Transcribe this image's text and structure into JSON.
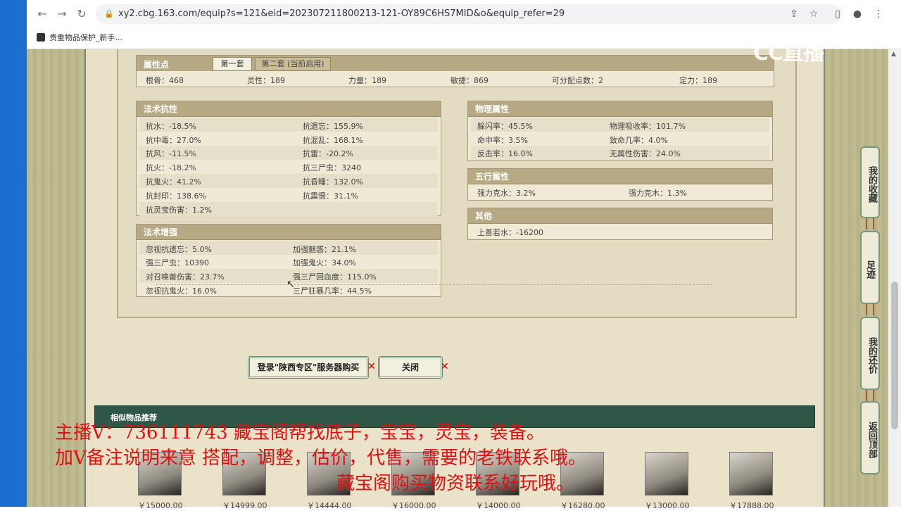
{
  "browser": {
    "url": "xy2.cbg.163.com/equip?s=121&eid=202307211800213-121-OY89C6HS7MID&o&equip_refer=29",
    "bookmark": "贵重物品保护_新手..."
  },
  "attributes": {
    "title": "属性点",
    "tabs": [
      "第一套",
      "第二套 (当前启用)"
    ],
    "stats": [
      "根骨：468",
      "灵性：189",
      "力量：189",
      "敏捷：869",
      "可分配点数：2",
      "定力：189"
    ]
  },
  "magic_resist": {
    "title": "法术抗性",
    "rows": [
      [
        "抗水：-18.5%",
        "抗遗忘：155.9%"
      ],
      [
        "抗中毒：27.0%",
        "抗混乱：168.1%"
      ],
      [
        "抗风：-11.5%",
        "抗雷：-20.2%"
      ],
      [
        "抗火：-18.2%",
        "抗三尸虫：3240"
      ],
      [
        "抗鬼火：41.2%",
        "抗昏睡：132.0%"
      ],
      [
        "抗封印：138.6%",
        "抗震慑：31.1%"
      ],
      [
        "抗灵宝伤害：1.2%",
        ""
      ]
    ]
  },
  "magic_boost": {
    "title": "法术增强",
    "rows": [
      [
        "忽视抗遗忘：5.0%",
        "加强魅惑：21.1%"
      ],
      [
        "强三尸虫：10390",
        "加强鬼火：34.0%"
      ],
      [
        "对召唤兽伤害：23.7%",
        "强三尸回血度：115.0%"
      ],
      [
        "忽视抗鬼火：16.0%",
        "三尸狂暴几率：44.5%"
      ]
    ]
  },
  "physical": {
    "title": "物理属性",
    "rows": [
      [
        "躲闪率：45.5%",
        "物理吸收率：101.7%"
      ],
      [
        "命中率：3.5%",
        "致命几率：4.0%"
      ],
      [
        "反击率：16.0%",
        "无属性伤害：24.0%"
      ]
    ]
  },
  "five_elements": {
    "title": "五行属性",
    "rows": [
      [
        "强力克水：3.2%",
        "强力克木：1.3%"
      ]
    ]
  },
  "other": {
    "title": "其他",
    "rows": [
      [
        "上善若水：-16200"
      ]
    ]
  },
  "buttons": {
    "login_buy": "登录\"陕西专区\"服务器购买",
    "close": "关闭"
  },
  "similar": {
    "title": "相似物品推荐",
    "prices": [
      "￥15000.00",
      "￥14999.00",
      "￥14444.00",
      "￥16000.00",
      "￥14000.00",
      "￥16280.00",
      "￥13000.00",
      "￥17888.00"
    ]
  },
  "side_nav": {
    "favorites": "我的收藏",
    "history": "足迹",
    "bargain": "我的还价",
    "top": "返回顶部"
  },
  "watermark": "CC直播",
  "overlay": {
    "line1": "主播V：736111743        藏宝阁帮找底子，宝宝，灵宝，装备。",
    "line2": "加V备注说明来意    搭配，调整，估价，代售，需要的老铁联系哦。",
    "line3": "藏宝阁购买物资联系好玩哦。"
  }
}
